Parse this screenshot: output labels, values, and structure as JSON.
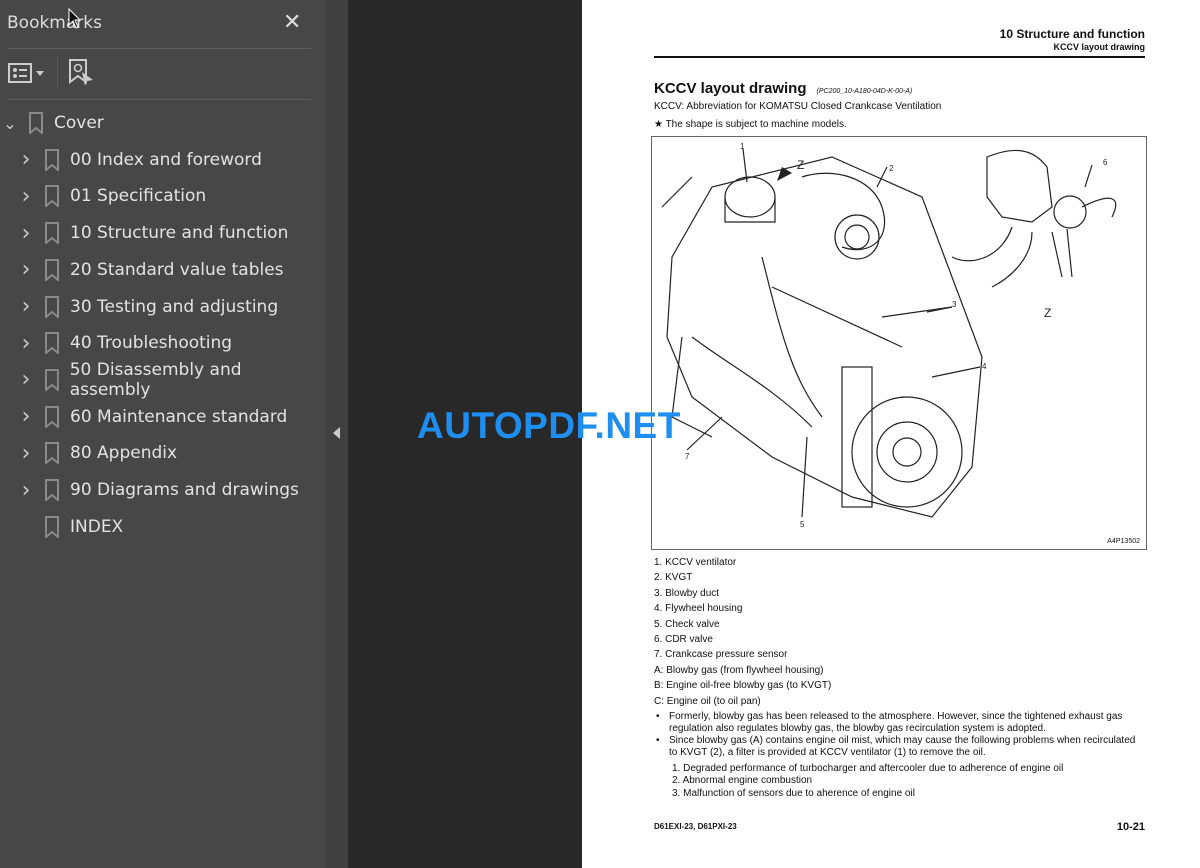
{
  "sidebar": {
    "title": "Bookmarks",
    "close_icon": "close-icon",
    "bookmarks": [
      {
        "label": "Cover",
        "expanded": true,
        "has_children": true
      },
      {
        "label": "00 Index and foreword",
        "has_children": true
      },
      {
        "label": "01 Specification",
        "has_children": true
      },
      {
        "label": "10 Structure and function",
        "has_children": true
      },
      {
        "label": "20 Standard value tables",
        "has_children": true
      },
      {
        "label": "30 Testing and adjusting",
        "has_children": true
      },
      {
        "label": "40 Troubleshooting",
        "has_children": true
      },
      {
        "label": "50 Disassembly and assembly",
        "has_children": true
      },
      {
        "label": "60 Maintenance standard",
        "has_children": true
      },
      {
        "label": "80 Appendix",
        "has_children": true
      },
      {
        "label": "90 Diagrams and drawings",
        "has_children": true
      },
      {
        "label": "INDEX",
        "has_children": false
      }
    ]
  },
  "page": {
    "header_section": "10 Structure and function",
    "header_sub": "KCCV layout drawing",
    "title": "KCCV layout drawing",
    "title_code": "(PC200_10-A180-04D-K-00-A)",
    "abbrev": "KCCV: Abbreviation for KOMATSU Closed Crankcase Ventilation",
    "note": "★  The shape is subject to machine models.",
    "figure": {
      "code": "A4P13502",
      "view_label": "Z",
      "callouts": [
        "1",
        "2",
        "3",
        "4",
        "5",
        "6",
        "7"
      ]
    },
    "legend": [
      "1. KCCV ventilator",
      "2. KVGT",
      "3. Blowby duct",
      "4. Flywheel housing",
      "5. Check valve",
      "6. CDR valve",
      "7. Crankcase pressure sensor",
      "A: Blowby gas (from flywheel housing)",
      "B: Engine oil-free blowby gas (to KVGT)",
      "C: Engine oil (to oil pan)"
    ],
    "bullets": [
      "Formerly, blowby gas has been released to the atmosphere. However, since the tightened exhaust gas regulation also regulates blowby gas, the blowby gas recirculation system is adopted.",
      "Since blowby gas (A) contains engine oil mist, which may cause the following problems when recirculated to KVGT (2), a filter is provided at KCCV ventilator (1) to remove the oil."
    ],
    "problems": [
      "1.  Degraded performance of turbocharger and aftercooler due to adherence of engine oil",
      "2.  Abnormal engine combustion",
      "3.  Malfunction of sensors due to aherence of engine oil"
    ],
    "footer_models": "D61EXI-23, D61PXI-23",
    "page_number": "10-21"
  },
  "watermark": "AUTOPDF.NET",
  "colors": {
    "sidebar": "#474747",
    "viewer_bg": "#282828",
    "watermark": "#1e8ff0"
  }
}
